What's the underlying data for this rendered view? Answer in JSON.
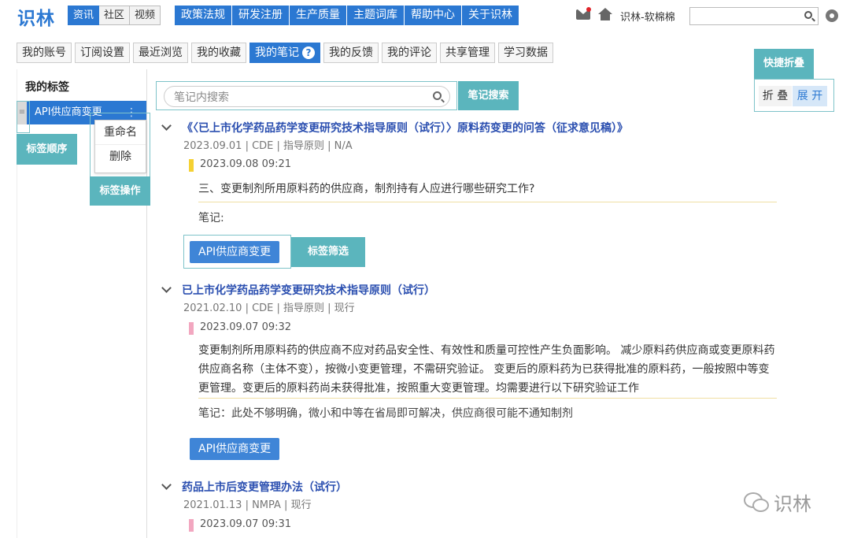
{
  "logo": "识林",
  "segments": [
    "资讯",
    "社区",
    "视频"
  ],
  "main_nav": [
    "政策法规",
    "研发注册",
    "生产质量",
    "主题词库",
    "帮助中心",
    "关于识林"
  ],
  "user": {
    "name": "识林-软棉棉"
  },
  "account_tabs": [
    "我的账号",
    "订阅设置",
    "最近浏览",
    "我的收藏",
    "我的笔记",
    "我的反馈",
    "我的评论",
    "共享管理",
    "学习数据"
  ],
  "sidebar": {
    "title": "我的标签",
    "tag_item": "API供应商变更",
    "drag_glyph": "≡",
    "kebab_glyph": "⋮",
    "menu": [
      "重命名",
      "删除"
    ]
  },
  "callouts": {
    "tag_order": "标签顺序",
    "tag_ops": "标签操作",
    "notes_search": "笔记搜索",
    "tag_filter": "标签筛选",
    "quick_fold": "快捷折叠"
  },
  "notes_search": {
    "placeholder": "笔记内搜索"
  },
  "fold": {
    "collapse": "折 叠",
    "expand": "展 开"
  },
  "notes": [
    {
      "title": "《〈已上市化学药品药学变更研究技术指导原则（试行）〉原料药变更的问答（征求意见稿）》",
      "meta": "2023.09.01 | CDE | 指导原则 | N/A",
      "time": "2023.09.08 09:21",
      "quote": "三、变更制剂所用原料药的供应商，制剂持有人应进行哪些研究工作?",
      "note": "笔记:",
      "tag": "API供应商变更"
    },
    {
      "title": "已上市化学药品药学变更研究技术指导原则（试行）",
      "meta": "2021.02.10 | CDE | 指导原则 | 现行",
      "time": "2023.09.07 09:32",
      "quote": "变更制剂所用原料药的供应商不应对药品安全性、有效性和质量可控性产生负面影响。 减少原料药供应商或变更原料药供应商名称（主体不变），按微小变更管理，不需研究验证。 变更后的原料药为已获得批准的原料药，一般按照中等变更管理。变更后的原料药尚未获得批准，按照重大变更管理。均需要进行以下研究验证工作",
      "note": "笔记：此处不够明确，微小和中等在省局即可解决，供应商很可能不通知制剂",
      "tag": "API供应商变更"
    },
    {
      "title": "药品上市后变更管理办法（试行）",
      "meta": "2021.01.13 | NMPA | 现行",
      "time": "2023.09.07 09:31"
    }
  ],
  "watermark": "识林",
  "colors": {
    "brand": "#2b78d2",
    "callout": "#5bb5bd",
    "highlight_yellow": "#f5d133",
    "highlight_pink": "#f2a7c0"
  }
}
